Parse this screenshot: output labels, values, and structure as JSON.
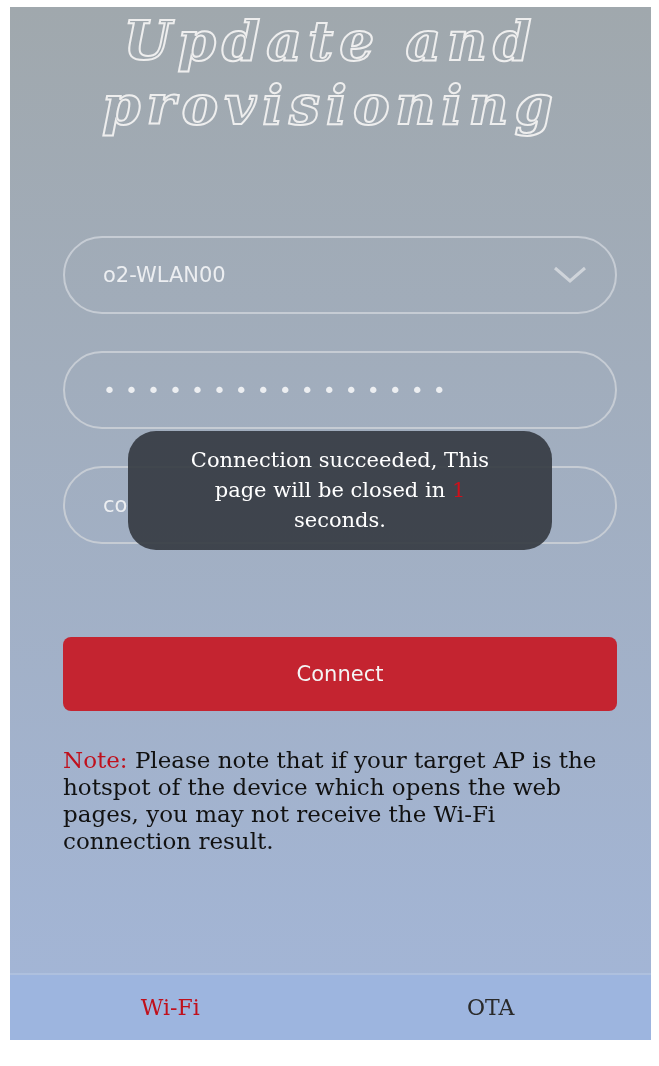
{
  "title": {
    "lines": [
      "Update and",
      "provisioning"
    ]
  },
  "network_select": {
    "value": "o2-WLAN00"
  },
  "password_field": {
    "value": "••••••••••••••••"
  },
  "status_field": {
    "value": "co"
  },
  "connect_button": {
    "label": "Connect"
  },
  "note": {
    "label": "Note:",
    "text": "Please note that if your target AP is the hotspot of the device which opens the web pages, you may not receive the Wi-Fi connection result."
  },
  "toast": {
    "before": "Connection succeeded, This page will be closed in",
    "count": "1",
    "after": "seconds."
  },
  "tabs": [
    {
      "label": "Wi-Fi",
      "selected": true
    },
    {
      "label": "OTA",
      "selected": false
    }
  ]
}
